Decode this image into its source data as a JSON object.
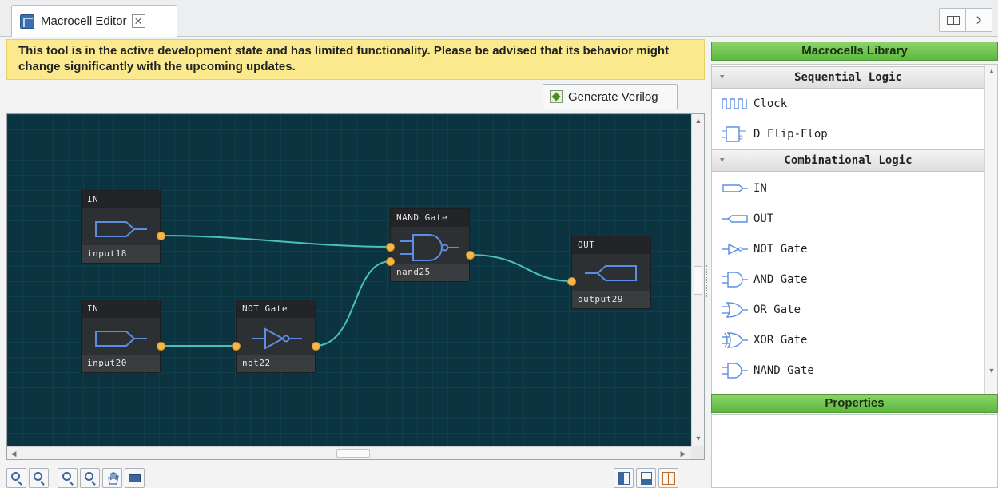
{
  "tab": {
    "title": "Macrocell Editor",
    "close_glyph": "✕"
  },
  "window_controls": {
    "chevron_glyph": "›"
  },
  "warning": "This tool is in the active development state and has limited functionality. Please be advised that its behavior might change significantly with the upcoming updates.",
  "toolbar": {
    "generate_label": "Generate Verilog"
  },
  "canvas": {
    "background": "#0b3440",
    "wire_color": "#49c1b8",
    "port_color": "#f7b64a",
    "nodes": [
      {
        "type": "IN",
        "name": "input18"
      },
      {
        "type": "IN",
        "name": "input20"
      },
      {
        "type": "NOT Gate",
        "name": "not22"
      },
      {
        "type": "NAND Gate",
        "name": "nand25"
      },
      {
        "type": "OUT",
        "name": "output29"
      }
    ]
  },
  "library": {
    "title": "Macrocells Library",
    "categories": [
      {
        "label": "Sequential Logic",
        "items": [
          "Clock",
          "D Flip-Flop"
        ]
      },
      {
        "label": "Combinational Logic",
        "items": [
          "IN",
          "OUT",
          "NOT Gate",
          "AND Gate",
          "OR Gate",
          "XOR Gate",
          "NAND Gate"
        ]
      }
    ]
  },
  "properties": {
    "title": "Properties"
  },
  "colors": {
    "accent_green": "#5cb83e",
    "warning_yellow": "#fbe98e",
    "icon_blue": "#3a66a0"
  }
}
